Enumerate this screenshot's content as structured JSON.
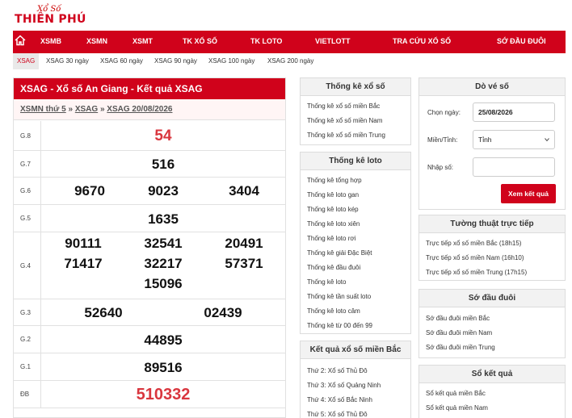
{
  "logo": {
    "top": "Xổ Số",
    "main": "THIÊN PHÚ"
  },
  "nav": [
    "XSMB",
    "XSMN",
    "XSMT",
    "TK XỔ SỐ",
    "TK LOTO",
    "VIETLOTT",
    "TRA CỨU XỔ SỐ",
    "SỚ ĐẦU ĐUÔI"
  ],
  "subnav": [
    "XSAG",
    "XSAG 30 ngày",
    "XSAG 60 ngày",
    "XSAG 90 ngày",
    "XSAG 100 ngày",
    "XSAG 200 ngày"
  ],
  "results": {
    "title": "XSAG - Xổ số An Giang - Kết quả XSAG",
    "crumb": [
      "XSMN thứ 5",
      "XSAG",
      "XSAG 20/08/2026"
    ],
    "rows": [
      {
        "label": "G.8",
        "nums": [
          "54"
        ]
      },
      {
        "label": "G.7",
        "nums": [
          "516"
        ]
      },
      {
        "label": "G.6",
        "nums": [
          "9670",
          "9023",
          "3404"
        ]
      },
      {
        "label": "G.5",
        "nums": [
          "1635"
        ]
      },
      {
        "label": "G.4",
        "nums": [
          "90111",
          "32541",
          "20491",
          "71417",
          "32217",
          "57371",
          "15096"
        ]
      },
      {
        "label": "G.3",
        "nums": [
          "52640",
          "02439"
        ]
      },
      {
        "label": "G.2",
        "nums": [
          "44895"
        ]
      },
      {
        "label": "G.1",
        "nums": [
          "89516"
        ]
      },
      {
        "label": "ĐB",
        "nums": [
          "510332"
        ]
      }
    ]
  },
  "tk_xoso": {
    "title": "Thống kê xổ số",
    "items": [
      "Thống kê xổ số miền Bắc",
      "Thống kê xổ số miền Nam",
      "Thống kê xổ số miền Trung"
    ]
  },
  "tk_loto": {
    "title": "Thống kê loto",
    "items": [
      "Thống kê tổng hợp",
      "Thống kê loto gan",
      "Thống kê loto kép",
      "Thống kê loto xiên",
      "Thống kê loto rơi",
      "Thống kê giải Đặc Biệt",
      "Thống kê đầu đuôi",
      "Thống kê loto",
      "Thống kê tần suất loto",
      "Thống kê loto câm",
      "Thống kê từ 00 đến 99"
    ]
  },
  "kq_mb": {
    "title": "Kết quả xổ số miền Bắc",
    "items": [
      "Thứ 2: Xổ số Thủ Đô",
      "Thứ 3: Xổ số Quảng Ninh",
      "Thứ 4: Xổ số Bắc Ninh",
      "Thứ 5: Xổ số Thủ Đô"
    ]
  },
  "dove": {
    "title": "Dò vé số",
    "date_label": "Chọn ngày:",
    "date_value": "25/08/2026",
    "province_label": "Miền/Tỉnh:",
    "province_value": "Tỉnh",
    "input_label": "Nhập số:",
    "input_value": "",
    "button": "Xem kết quả"
  },
  "tuong_thuat": {
    "title": "Tường thuật trực tiếp",
    "items": [
      "Trực tiếp xổ số miền Bắc (18h15)",
      "Trực tiếp xổ số miền Nam (16h10)",
      "Trực tiếp xổ số miền Trung (17h15)"
    ]
  },
  "so_dau_duoi": {
    "title": "Sớ đầu đuôi",
    "items": [
      "Sớ đầu đuôi miền Bắc",
      "Sớ đầu đuôi miền Nam",
      "Sớ đầu đuôi miền Trung"
    ]
  },
  "so_ket_qua": {
    "title": "Sổ kết quả",
    "items": [
      "Sổ kết quả miền Bắc",
      "Sổ kết quả miền Nam"
    ]
  },
  "colors": {
    "brand": "#d0021b",
    "special": "#d9363e"
  }
}
